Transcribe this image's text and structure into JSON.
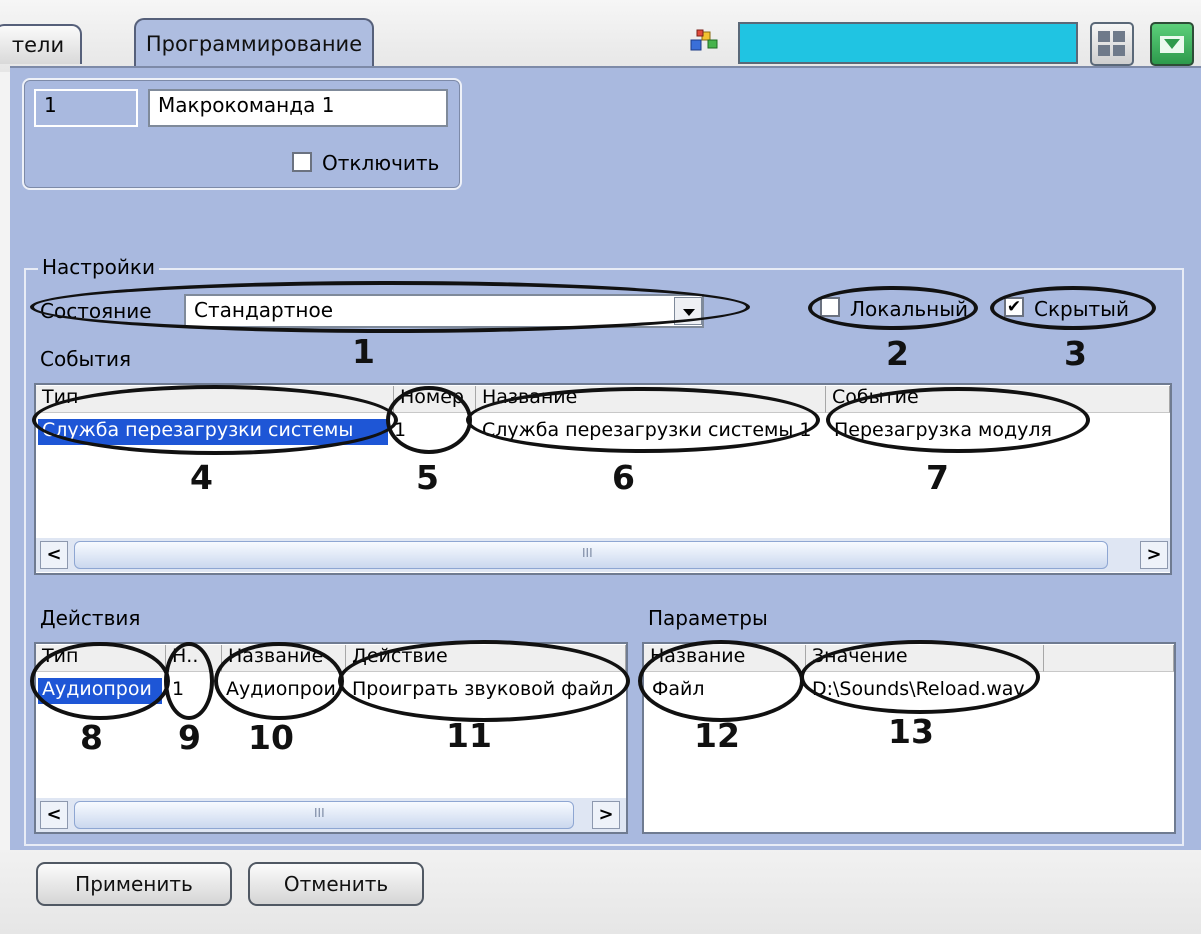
{
  "tabs": [
    {
      "label": "тели"
    },
    {
      "label": "Программирование"
    }
  ],
  "header": {
    "search_value": ""
  },
  "macro": {
    "id": "1",
    "name": "Макрокоманда 1",
    "disable_label": "Отключить"
  },
  "settings": {
    "title": "Настройки",
    "state_label": "Состояние",
    "state_value": "Стандартное",
    "local_label": "Локальный",
    "hidden_label": "Скрытый",
    "hidden_checked": true,
    "local_checked": false
  },
  "events": {
    "title": "События",
    "columns": [
      "Тип",
      "Номер",
      "Название",
      "Событие"
    ],
    "rows": [
      [
        "Служба перезагрузки системы",
        "1",
        "Служба перезагрузки системы 1",
        "Перезагрузка модуля"
      ]
    ]
  },
  "actions": {
    "title": "Действия",
    "columns": [
      "Тип",
      "Н..",
      "Название",
      "Действие"
    ],
    "rows": [
      [
        "Аудиопрои",
        "1",
        "Аудиопрои",
        "Проиграть звуковой файл"
      ]
    ]
  },
  "params": {
    "title": "Параметры",
    "columns": [
      "Название",
      "Значение"
    ],
    "rows": [
      [
        "Файл",
        "D:\\Sounds\\Reload.wav"
      ]
    ]
  },
  "callouts": [
    "1",
    "2",
    "3",
    "4",
    "5",
    "6",
    "7",
    "8",
    "9",
    "10",
    "11",
    "12",
    "13"
  ],
  "buttons": {
    "apply": "Применить",
    "cancel": "Отменить"
  },
  "scroll": {
    "mark": "III"
  },
  "colors": {
    "panel": "#a9b9df",
    "accent_field": "#20c4e2",
    "selection": "#1e56d6"
  }
}
